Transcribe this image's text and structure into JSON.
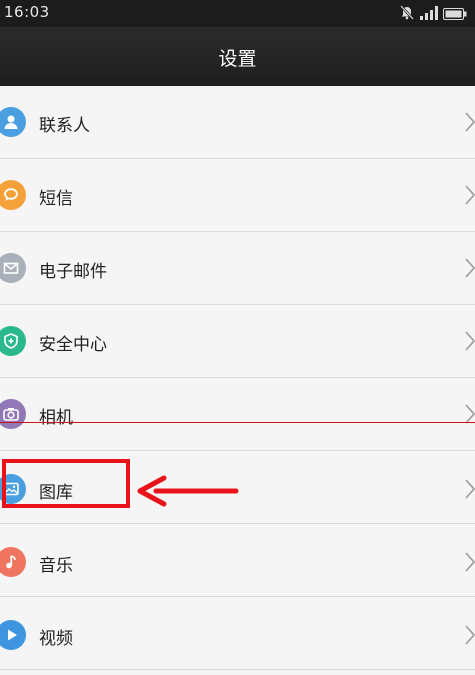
{
  "status_bar": {
    "time": "16:03",
    "icons": [
      "mute-icon",
      "signal-icon",
      "battery-icon"
    ]
  },
  "header": {
    "title": "设置"
  },
  "items": [
    {
      "label": "联系人",
      "icon": "contacts-icon",
      "color": "#4a9fe0"
    },
    {
      "label": "短信",
      "icon": "message-icon",
      "color": "#f4a13a"
    },
    {
      "label": "电子邮件",
      "icon": "email-icon",
      "color": "#a9b0b9"
    },
    {
      "label": "安全中心",
      "icon": "shield-icon",
      "color": "#2bb88c"
    },
    {
      "label": "相机",
      "icon": "camera-icon",
      "color": "#9378b8"
    },
    {
      "label": "图库",
      "icon": "gallery-icon",
      "color": "#4a9fe0"
    },
    {
      "label": "音乐",
      "icon": "music-icon",
      "color": "#ef7560"
    },
    {
      "label": "视频",
      "icon": "video-icon",
      "color": "#3f95e0"
    }
  ],
  "annotation": {
    "highlight_color": "#e8141a",
    "highlighted_item": "图库"
  }
}
